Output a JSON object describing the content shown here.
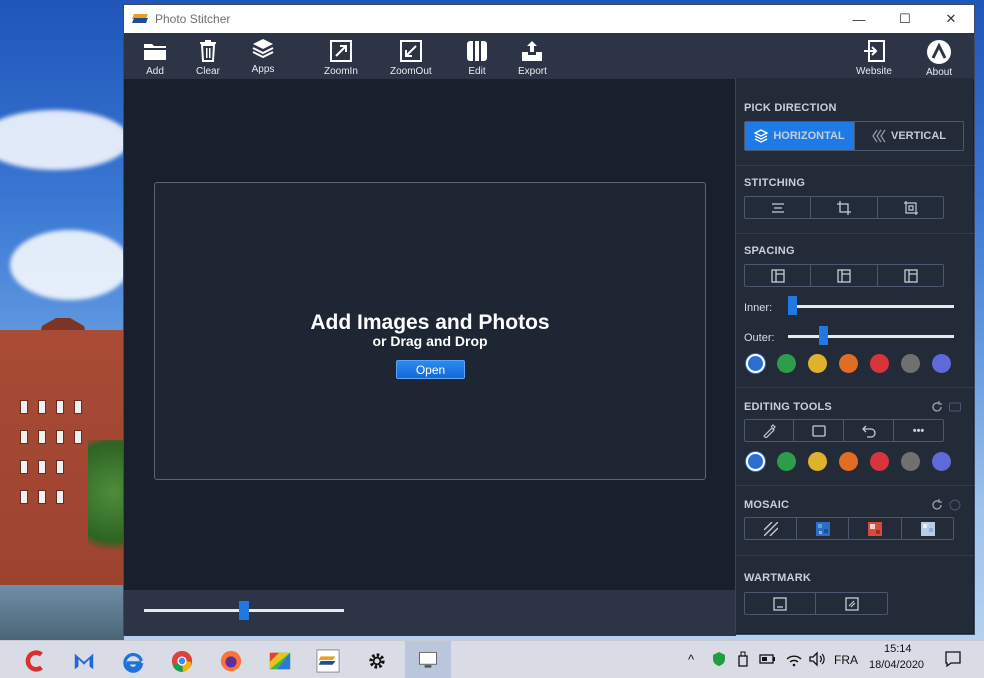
{
  "window": {
    "title": "Photo Stitcher",
    "controls": {
      "minimize": "—",
      "maximize": "☐",
      "close": "✕"
    }
  },
  "toolbar": {
    "add": "Add",
    "clear": "Clear",
    "apps": "Apps",
    "zoom_in": "ZoomIn",
    "zoom_out": "ZoomOut",
    "edit": "Edit",
    "export": "Export",
    "website": "Website",
    "about": "About"
  },
  "canvas": {
    "title": "Add Images and Photos",
    "subtitle": "or Drag and Drop",
    "open_button": "Open",
    "zoom_level": 0.5
  },
  "panel": {
    "pick_direction": {
      "label": "PICK DIRECTION",
      "horizontal": "HORIZONTAL",
      "vertical": "VERTICAL",
      "selected": "HORIZONTAL"
    },
    "stitching": {
      "label": "STITCHING"
    },
    "spacing": {
      "label": "SPACING",
      "inner_label": "Inner:",
      "outer_label": "Outer:",
      "inner_value": 0.0,
      "outer_value": 0.2
    },
    "spacing_colors": [
      "#2c6fcf",
      "#2e9c4a",
      "#e0b12a",
      "#e06d23",
      "#d9343c",
      "#707070",
      "#5f6ad8"
    ],
    "editing_tools": {
      "label": "EDITING TOOLS",
      "more": "•••"
    },
    "editing_colors": [
      "#2c6fcf",
      "#2e9c4a",
      "#e0b12a",
      "#e06d23",
      "#d9343c",
      "#707070",
      "#5f6ad8"
    ],
    "mosaic": {
      "label": "MOSAIC"
    },
    "watermark": {
      "label": "WARTMARK"
    }
  },
  "taskbar": {
    "apps": [
      "ccleaner-icon",
      "malwarebytes-icon",
      "edge-icon",
      "chrome-icon",
      "firefox-icon",
      "colors-app-icon",
      "photo-stitcher-icon",
      "settings-icon",
      "desktop-app-icon"
    ],
    "language": "FRA",
    "time": "15:14",
    "date": "18/04/2020"
  }
}
